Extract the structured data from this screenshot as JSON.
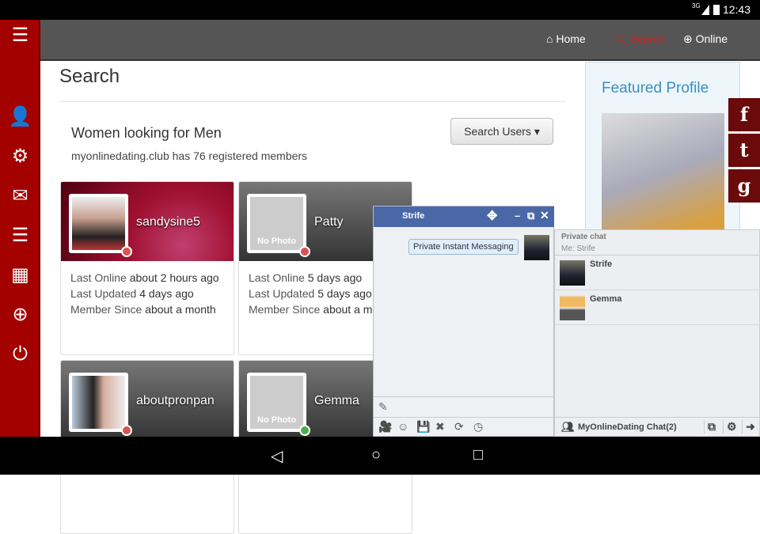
{
  "status": {
    "time": "12:43",
    "network": "3G"
  },
  "sidebar": {
    "items": [
      {
        "icon": "menu-icon",
        "glyph": "☰"
      },
      {
        "icon": "user-icon",
        "glyph": "👤"
      },
      {
        "icon": "gears-icon",
        "glyph": "⚙"
      },
      {
        "icon": "envelope-icon",
        "glyph": "✉"
      },
      {
        "icon": "comments-icon",
        "glyph": "☰"
      },
      {
        "icon": "calendar-icon",
        "glyph": "▦"
      },
      {
        "icon": "plus-circle-icon",
        "glyph": "⊕"
      },
      {
        "icon": "power-icon",
        "glyph": "⏻"
      }
    ]
  },
  "nav": {
    "home": "Home",
    "search": "Search",
    "online": "Online"
  },
  "page": {
    "title": "Search",
    "subtitle": "Women looking for Men",
    "count": "myonlinedating.club has 76 registered members",
    "search_button": "Search Users ▾"
  },
  "members": [
    {
      "name": "sandysine5",
      "last_online_label": "Last Online",
      "last_online": "about 2 hours ago",
      "last_updated_label": "Last Updated",
      "last_updated": "4 days ago",
      "since_label": "Member Since",
      "since": "about a month",
      "status": "offline"
    },
    {
      "name": "Patty",
      "last_online_label": "Last Online",
      "last_online": "5 days ago",
      "last_updated_label": "Last Updated",
      "last_updated": "5 days ago",
      "since_label": "Member Since",
      "since": "about a month",
      "status": "offline",
      "photo_text": "No Photo"
    },
    {
      "name": "aboutpronpan",
      "status": "offline"
    },
    {
      "name": "Gemma",
      "status": "online",
      "photo_text": "No Photo"
    }
  ],
  "featured": {
    "title": "Featured Profile"
  },
  "social": [
    {
      "icon": "facebook-icon",
      "glyph": "f"
    },
    {
      "icon": "twitter-icon",
      "glyph": "t"
    },
    {
      "icon": "google-icon",
      "glyph": "g"
    }
  ],
  "chat": {
    "title": "Strife",
    "message": "Private Instant Messaging",
    "tools": [
      "🎥",
      "☺",
      "💾",
      "✖",
      "⟳",
      "◷"
    ]
  },
  "buddy_list": {
    "header": "Private chat",
    "me": "Me: Strife",
    "buddies": [
      "Strife",
      "Gemma"
    ],
    "footer": "MyOnlineDating Chat(2)"
  },
  "colors": {
    "sidebar": "#a30000",
    "accent": "#d42020",
    "chat_bar": "#4a68a8"
  }
}
